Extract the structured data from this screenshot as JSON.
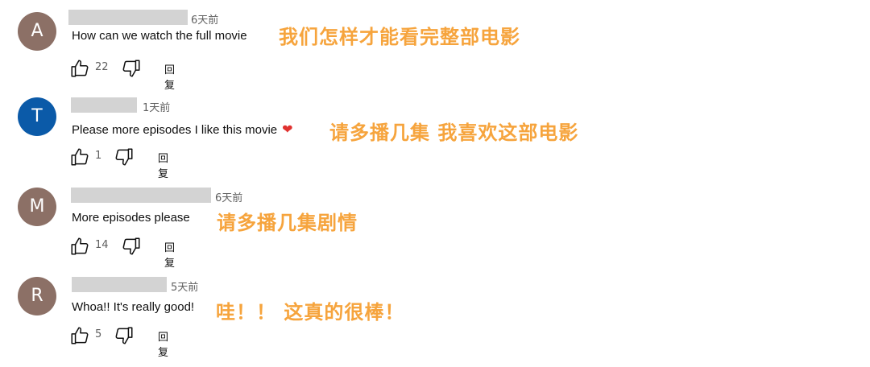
{
  "comments": [
    {
      "avatar_letter": "A",
      "avatar_color": "#8c7066",
      "time": "6天前",
      "text": "How can we watch the full movie",
      "translation": "我们怎样才能看完整部电影",
      "likes": "22",
      "reply_label": "回复"
    },
    {
      "avatar_letter": "T",
      "avatar_color": "#0b5aa8",
      "time": "1天前",
      "text": "Please more episodes I like this movie",
      "heart": "❤",
      "translation": "请多播几集 我喜欢这部电影",
      "likes": "1",
      "reply_label": "回复"
    },
    {
      "avatar_letter": "M",
      "avatar_color": "#8c7066",
      "time": "6天前",
      "text": "More episodes please",
      "translation": "请多播几集剧情",
      "likes": "14",
      "reply_label": "回复"
    },
    {
      "avatar_letter": "R",
      "avatar_color": "#8c7066",
      "time": "5天前",
      "text": "Whoa!! It's really good!",
      "translation": "哇！！ 这真的很棒！",
      "likes": "5",
      "reply_label": "回复"
    }
  ]
}
